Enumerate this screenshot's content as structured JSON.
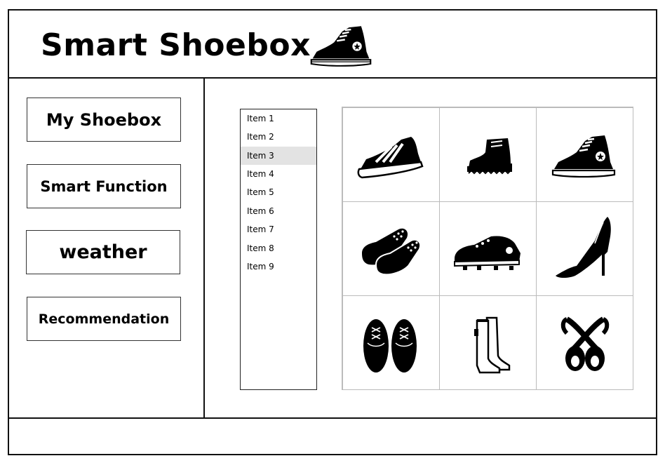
{
  "header": {
    "title": "Smart Shoebox",
    "logo_icon": "high-top-sneaker-icon"
  },
  "sidebar": {
    "items": [
      {
        "label": "My Shoebox"
      },
      {
        "label": "Smart Function"
      },
      {
        "label": "weather"
      },
      {
        "label": "Recommendation"
      }
    ]
  },
  "list": {
    "items": [
      "Item 1",
      "Item 2",
      "Item 3",
      "Item 4",
      "Item 5",
      "Item 6",
      "Item 7",
      "Item 8",
      "Item 9"
    ],
    "selected": "Item 3"
  },
  "grid": {
    "shoes": [
      "striped-sneaker-icon",
      "work-boot-icon",
      "high-top-sneaker-icon",
      "slippers-icon",
      "cleats-icon",
      "high-heel-icon",
      "dress-shoes-icon",
      "rain-boots-icon",
      "ballet-flats-icon"
    ]
  }
}
